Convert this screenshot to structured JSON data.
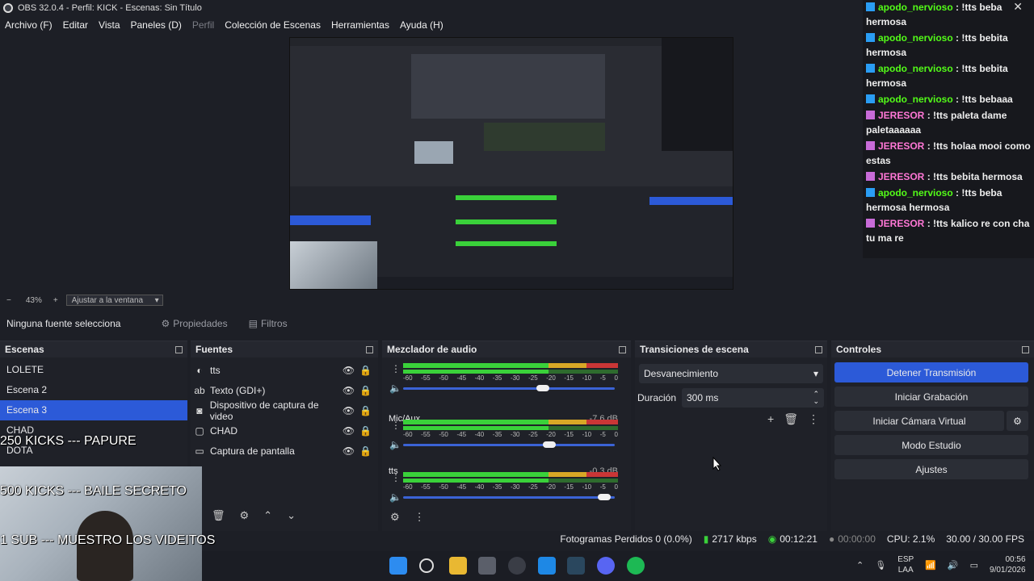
{
  "window": {
    "title": "OBS 32.0.4 - Perfil: KICK - Escenas: Sin Título"
  },
  "menu": [
    {
      "label": "Archivo (F)",
      "disabled": false
    },
    {
      "label": "Editar",
      "disabled": false
    },
    {
      "label": "Vista",
      "disabled": false
    },
    {
      "label": "Paneles (D)",
      "disabled": false
    },
    {
      "label": "Perfil",
      "disabled": true
    },
    {
      "label": "Colección de Escenas",
      "disabled": false
    },
    {
      "label": "Herramientas",
      "disabled": false
    },
    {
      "label": "Ayuda (H)",
      "disabled": false
    }
  ],
  "zoom": {
    "value": "43%",
    "fit_label": "Ajustar a la ventana"
  },
  "source_bar": {
    "none_selected": "Ninguna fuente selecciona",
    "properties": "Propiedades",
    "filters": "Filtros"
  },
  "scenes": {
    "title": "Escenas",
    "items": [
      "LOLETE",
      "Escena 2",
      "Escena 3",
      "CHAD",
      "DOTA"
    ],
    "selected_index": 2
  },
  "sources": {
    "title": "Fuentes",
    "items": [
      {
        "label": "tts",
        "icon": "audio-icon"
      },
      {
        "label": "Texto (GDI+)",
        "icon": "text-icon"
      },
      {
        "label": "Dispositivo de captura de video",
        "icon": "camera-icon"
      },
      {
        "label": "CHAD",
        "icon": "scene-icon"
      },
      {
        "label": "Captura de pantalla",
        "icon": "monitor-icon"
      }
    ]
  },
  "mixer": {
    "title": "Mezclador de audio",
    "ticks": [
      "-60",
      "-55",
      "-50",
      "-45",
      "-40",
      "-35",
      "-30",
      "-25",
      "-20",
      "-15",
      "-10",
      "-5",
      "0"
    ],
    "channels": [
      {
        "name": "",
        "db": "",
        "volume": 0.66
      },
      {
        "name": "Mic/Aux",
        "db": "-7.6 dB",
        "volume": 0.69
      },
      {
        "name": "tts",
        "db": "-0.3 dB",
        "volume": 0.95
      }
    ]
  },
  "transitions": {
    "title": "Transiciones de escena",
    "selected": "Desvanecimiento",
    "duration_label": "Duración",
    "duration_value": "300 ms"
  },
  "controls": {
    "title": "Controles",
    "buttons": [
      "Detener Transmisión",
      "Iniciar Grabación",
      "Iniciar Cámara Virtual",
      "Modo Estudio",
      "Ajustes"
    ]
  },
  "status": {
    "dropped": "Fotogramas Perdidos 0 (0.0%)",
    "kbps": "2717 kbps",
    "stream_time": "00:12:21",
    "rec_time": "00:00:00",
    "cpu": "CPU: 2.1%",
    "fps": "30.00 / 30.00 FPS"
  },
  "overlay": {
    "lines": [
      "250 KICKS --- PAPURE",
      "500 KICKS --- BAILE SECRETO",
      "1 SUB --- MUESTRO LOS VIDEITOS"
    ]
  },
  "chat": {
    "messages": [
      {
        "user": "apodo_nervioso",
        "text": ": !tts beba hermosa",
        "badge": "kick"
      },
      {
        "user": "apodo_nervioso",
        "text": ": !tts bebita hermosa",
        "badge": "kick"
      },
      {
        "user": "apodo_nervioso",
        "text": ": !tts bebita hermosa",
        "badge": "kick"
      },
      {
        "user": "apodo_nervioso",
        "text": ": !tts bebaaa",
        "badge": "kick"
      },
      {
        "user": "JERESOR",
        "text": ": !tts paleta dame paletaaaaaa",
        "badge": "mic"
      },
      {
        "user": "JERESOR",
        "text": ": !tts holaa mooi como estas",
        "badge": "mic"
      },
      {
        "user": "JERESOR",
        "text": ": !tts bebita hermosa",
        "badge": "mic"
      },
      {
        "user": "apodo_nervioso",
        "text": ": !tts beba hermosa hermosa",
        "badge": "kick"
      },
      {
        "user": "JERESOR",
        "text": ": !tts kalico re con cha tu ma re",
        "badge": "mic"
      }
    ]
  },
  "tray": {
    "lang1": "ESP",
    "lang2": "LAA",
    "time": "00:56",
    "date": "9/01/2026"
  },
  "colors": {
    "accent": "#2c5ad8",
    "kick_green": "#53fc18",
    "meter_green": "#3ad13a",
    "meter_yellow": "#d8a726",
    "meter_red": "#c93636",
    "user_green": "#53fc18",
    "user_pink": "#ff77d6"
  }
}
